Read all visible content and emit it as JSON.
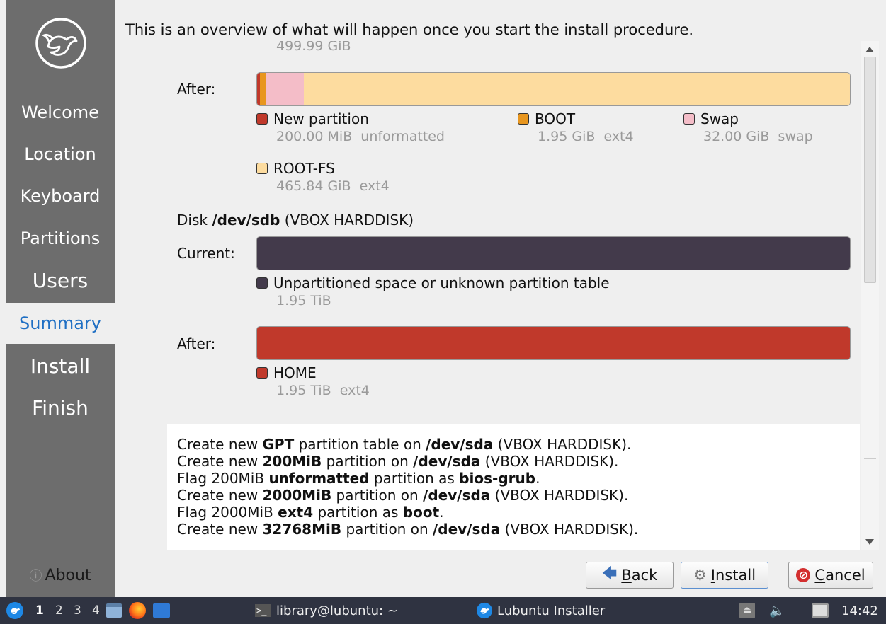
{
  "sidebar": {
    "steps": [
      {
        "label": "Welcome"
      },
      {
        "label": "Location"
      },
      {
        "label": "Keyboard"
      },
      {
        "label": "Partitions"
      },
      {
        "label": "Users"
      },
      {
        "label": "Summary"
      },
      {
        "label": "Install"
      },
      {
        "label": "Finish"
      }
    ],
    "active_step": "Summary",
    "about_label": "About"
  },
  "header": {
    "text": "This is an overview of what will happen once you start the install procedure."
  },
  "summary": {
    "top_cut_text": "499.99 GiB",
    "sda_after": {
      "label": "After:",
      "segments": [
        {
          "name": "New partition",
          "detail": "200.00 MiB  unformatted",
          "color": "#c0392b",
          "fraction": 0.0004
        },
        {
          "name": "BOOT",
          "detail": "1.95 GiB  ext4",
          "color": "#e8961e",
          "fraction": 0.004
        },
        {
          "name": "Swap",
          "detail": "32.00 GiB  swap",
          "color": "#f4bdc8",
          "fraction": 0.064
        },
        {
          "name": "ROOT-FS",
          "detail": "465.84 GiB  ext4",
          "color": "#fddc9f",
          "fraction": 0.9316
        }
      ]
    },
    "sdb": {
      "disk_prefix": "Disk",
      "disk_name": "/dev/sdb",
      "disk_model": "(VBOX HARDDISK)",
      "current_label": "Current:",
      "current_legend": {
        "name": "Unpartitioned space or unknown partition table",
        "detail": "1.95 TiB",
        "color": "#433a4b"
      },
      "after_label": "After:",
      "after_legend": {
        "name": "HOME",
        "detail": "1.95 TiB  ext4",
        "color": "#c0392b"
      }
    }
  },
  "operations": [
    [
      "Create new ",
      "GPT",
      " partition table on ",
      "/dev/sda",
      " (VBOX HARDDISK)."
    ],
    [
      "Create new ",
      "200MiB",
      " partition on ",
      "/dev/sda",
      " (VBOX HARDDISK)."
    ],
    [
      "Flag 200MiB ",
      "unformatted",
      " partition as ",
      "bios-grub",
      "."
    ],
    [
      "Create new ",
      "2000MiB",
      " partition on ",
      "/dev/sda",
      " (VBOX HARDDISK)."
    ],
    [
      "Flag 2000MiB ",
      "ext4",
      " partition as ",
      "boot",
      "."
    ],
    [
      "Create new ",
      "32768MiB",
      " partition on ",
      "/dev/sda",
      " (VBOX HARDDISK)."
    ]
  ],
  "buttons": {
    "back": {
      "label_pre": "",
      "label_u": "B",
      "label_post": "ack"
    },
    "install": {
      "label_pre": "",
      "label_u": "I",
      "label_post": "nstall"
    },
    "cancel": {
      "label_pre": "",
      "label_u": "C",
      "label_post": "ancel"
    }
  },
  "taskbar": {
    "workspaces": [
      "1",
      "2",
      "3",
      "4"
    ],
    "current_workspace": "1",
    "terminal_title": "library@lubuntu: ~",
    "installer_title": "Lubuntu Installer",
    "clock": "14:42"
  },
  "colors": {
    "sidebar_bg": "#6d6d6d",
    "active_step_text": "#1f6fc4",
    "taskbar_bg": "#2f3341"
  }
}
